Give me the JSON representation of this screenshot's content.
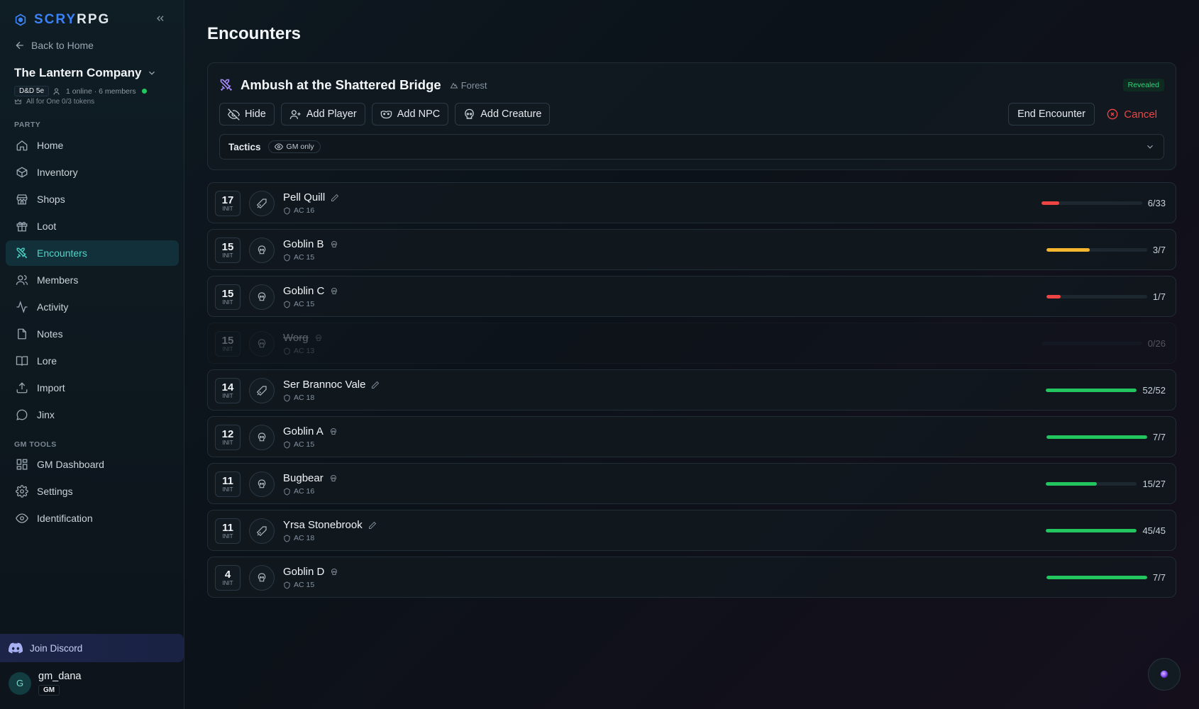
{
  "brand": {
    "part1": "SCRY",
    "part2": "RPG"
  },
  "sidebar": {
    "back_label": "Back to Home",
    "party_name": "The Lantern Company",
    "system": "D&D 5e",
    "presence": "1 online · 6 members",
    "tokens": "All for One 0/3 tokens",
    "party_section": "PARTY",
    "party_items": [
      {
        "label": "Home",
        "icon": "home-icon"
      },
      {
        "label": "Inventory",
        "icon": "box-icon"
      },
      {
        "label": "Shops",
        "icon": "store-icon"
      },
      {
        "label": "Loot",
        "icon": "gift-icon"
      },
      {
        "label": "Encounters",
        "icon": "swords-icon",
        "active": true
      },
      {
        "label": "Members",
        "icon": "users-icon"
      },
      {
        "label": "Activity",
        "icon": "activity-icon"
      },
      {
        "label": "Notes",
        "icon": "file-icon"
      },
      {
        "label": "Lore",
        "icon": "book-icon"
      },
      {
        "label": "Import",
        "icon": "upload-icon"
      },
      {
        "label": "Jinx",
        "icon": "chat-icon"
      }
    ],
    "gm_section": "GM TOOLS",
    "gm_items": [
      {
        "label": "GM Dashboard",
        "icon": "grid-icon"
      },
      {
        "label": "Settings",
        "icon": "gear-icon"
      },
      {
        "label": "Identification",
        "icon": "eye-icon"
      }
    ],
    "discord_label": "Join Discord",
    "user": {
      "initial": "G",
      "name": "gm_dana",
      "role": "GM"
    }
  },
  "page": {
    "title": "Encounters"
  },
  "encounter": {
    "title": "Ambush at the Shattered Bridge",
    "location": "Forest",
    "status": "Revealed",
    "buttons": {
      "hide": "Hide",
      "add_player": "Add Player",
      "add_npc": "Add NPC",
      "add_creature": "Add Creature",
      "end": "End Encounter",
      "cancel": "Cancel"
    },
    "tactics": {
      "label": "Tactics",
      "visibility": "GM only"
    }
  },
  "combatants": [
    {
      "init": "17",
      "init_label": "INIT",
      "name": "Pell Quill",
      "kind": "player",
      "ac": "AC 16",
      "hp": "6/33",
      "hp_frac": 0.18,
      "hp_color": "#ef4444",
      "defeated": false
    },
    {
      "init": "15",
      "init_label": "INIT",
      "name": "Goblin B",
      "kind": "creature",
      "ac": "AC 15",
      "hp": "3/7",
      "hp_frac": 0.43,
      "hp_color": "#f5b52c",
      "defeated": false
    },
    {
      "init": "15",
      "init_label": "INIT",
      "name": "Goblin C",
      "kind": "creature",
      "ac": "AC 15",
      "hp": "1/7",
      "hp_frac": 0.14,
      "hp_color": "#ef4444",
      "defeated": false
    },
    {
      "init": "15",
      "init_label": "INIT",
      "name": "Worg",
      "kind": "creature",
      "ac": "AC 13",
      "hp": "0/26",
      "hp_frac": 0,
      "hp_color": "#ef4444",
      "defeated": true
    },
    {
      "init": "14",
      "init_label": "INIT",
      "name": "Ser Brannoc Vale",
      "kind": "player",
      "ac": "AC 18",
      "hp": "52/52",
      "hp_frac": 1,
      "hp_color": "#22c55e",
      "defeated": false
    },
    {
      "init": "12",
      "init_label": "INIT",
      "name": "Goblin A",
      "kind": "creature",
      "ac": "AC 15",
      "hp": "7/7",
      "hp_frac": 1,
      "hp_color": "#22c55e",
      "defeated": false
    },
    {
      "init": "11",
      "init_label": "INIT",
      "name": "Bugbear",
      "kind": "creature",
      "ac": "AC 16",
      "hp": "15/27",
      "hp_frac": 0.56,
      "hp_color": "#22c55e",
      "defeated": false
    },
    {
      "init": "11",
      "init_label": "INIT",
      "name": "Yrsa Stonebrook",
      "kind": "player",
      "ac": "AC 18",
      "hp": "45/45",
      "hp_frac": 1,
      "hp_color": "#22c55e",
      "defeated": false
    },
    {
      "init": "4",
      "init_label": "INIT",
      "name": "Goblin D",
      "kind": "creature",
      "ac": "AC 15",
      "hp": "7/7",
      "hp_frac": 1,
      "hp_color": "#22c55e",
      "defeated": false
    }
  ]
}
